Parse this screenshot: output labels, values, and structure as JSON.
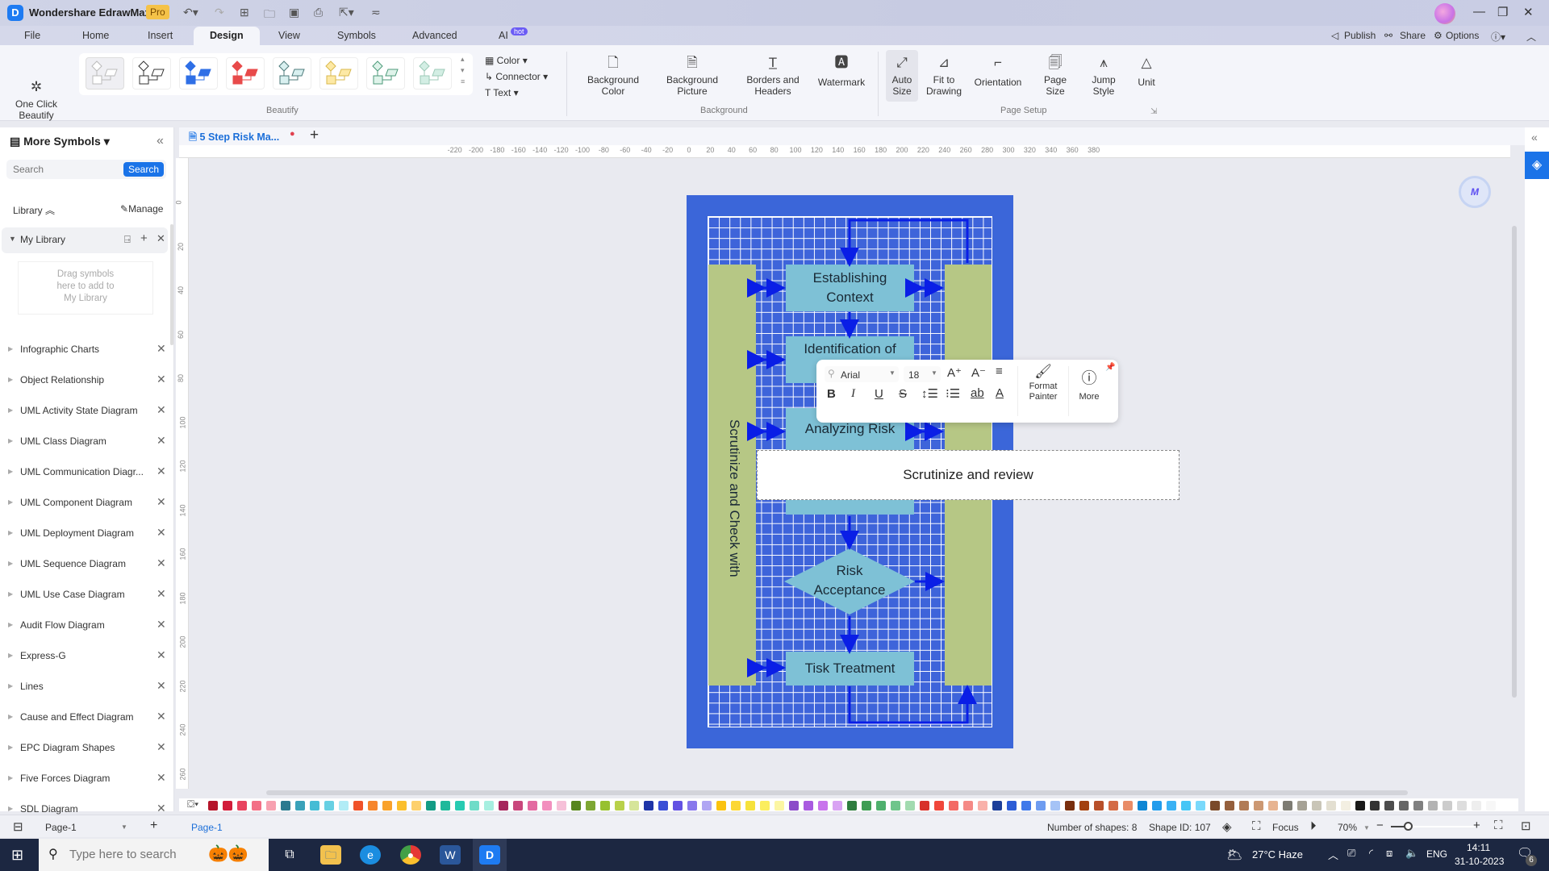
{
  "app": {
    "title": "Wondershare EdrawMax",
    "badge": "Pro",
    "window_controls": [
      "minimize",
      "restore",
      "close"
    ]
  },
  "quick_access": [
    "undo",
    "redo",
    "new",
    "open",
    "save",
    "print",
    "export",
    "customize"
  ],
  "menu": {
    "tabs": [
      "File",
      "Home",
      "Insert",
      "Design",
      "View",
      "Symbols",
      "Advanced",
      "AI"
    ],
    "active": "Design",
    "ai_badge": "hot",
    "right": {
      "publish": "Publish",
      "share": "Share",
      "options": "Options"
    }
  },
  "ribbon": {
    "one_click_beautify": "One Click\nBeautify",
    "beautify_label": "Beautify",
    "color": "Color",
    "connector": "Connector",
    "text": "Text",
    "background_group": "Background",
    "background_color": "Background\nColor",
    "background_picture": "Background\nPicture",
    "borders_headers": "Borders and\nHeaders",
    "watermark": "Watermark",
    "page_setup_group": "Page Setup",
    "auto_size": "Auto\nSize",
    "fit_to_drawing": "Fit to\nDrawing",
    "orientation": "Orientation",
    "page_size": "Page\nSize",
    "jump_style": "Jump\nStyle",
    "unit": "Unit"
  },
  "left_panel": {
    "title": "More Symbols",
    "search_placeholder": "Search",
    "search_button": "Search",
    "library_label": "Library",
    "manage_label": "Manage",
    "my_library": "My Library",
    "drop_hint": "Drag symbols\nhere to add to\nMy Library",
    "libraries": [
      "Infographic Charts",
      "Object Relationship",
      "UML Activity State Diagram",
      "UML Class Diagram",
      "UML Communication Diagr...",
      "UML Component Diagram",
      "UML Deployment Diagram",
      "UML Sequence Diagram",
      "UML Use Case Diagram",
      "Audit Flow Diagram",
      "Express-G",
      "Lines",
      "Cause and Effect Diagram",
      "EPC Diagram Shapes",
      "Five Forces Diagram",
      "SDL Diagram"
    ]
  },
  "document": {
    "tab_title": "5 Step Risk Ma...",
    "unsaved": true
  },
  "rulers": {
    "horizontal": [
      "-220",
      "-200",
      "-180",
      "-160",
      "-140",
      "-120",
      "-100",
      "-80",
      "-60",
      "-40",
      "-20",
      "0",
      "20",
      "40",
      "60",
      "80",
      "100",
      "120",
      "140",
      "160",
      "180",
      "200",
      "220",
      "240",
      "260",
      "280",
      "300",
      "320",
      "340",
      "360",
      "380"
    ],
    "vertical": [
      "0",
      "20",
      "40",
      "60",
      "80",
      "100",
      "120",
      "140",
      "160",
      "180",
      "200",
      "220",
      "240",
      "260"
    ]
  },
  "diagram": {
    "steps": [
      "Establishing\nContext",
      "Identification of",
      "Analyzing Risk",
      "Risk\nAcceptance",
      "Tisk Treatment"
    ],
    "side_label": "Scrutinize and Check with",
    "editing_text": "Scrutinize and review",
    "colors": {
      "page": "#3b66d9",
      "box": "#7ec1d6",
      "side": "#b6c785",
      "arrow": "#0a1ee6"
    }
  },
  "floating_toolbar": {
    "font": "Arial",
    "size": "18",
    "format_painter": "Format\nPainter",
    "more": "More"
  },
  "palette": [
    "#b5152b",
    "#d21c3a",
    "#e8435f",
    "#f36f86",
    "#f7a1b0",
    "#2b7a8f",
    "#3aa2b9",
    "#45bcd5",
    "#67d0e3",
    "#b1ecf6",
    "#f0522a",
    "#f6862e",
    "#f9a22b",
    "#fbbf2d",
    "#fdd06c",
    "#139c85",
    "#1fb99b",
    "#27cbb2",
    "#6fdcc8",
    "#a7efe0",
    "#a6265c",
    "#c9477c",
    "#e36aa1",
    "#f28fbe",
    "#f6c0d8",
    "#57861f",
    "#7ea733",
    "#97c12f",
    "#b9d14a",
    "#d6e59a",
    "#1f35a8",
    "#3a4fd6",
    "#6352e3",
    "#8878ec",
    "#b0a6f3",
    "#fbc310",
    "#fcd734",
    "#f6e23b",
    "#fbee5e",
    "#fcf6a3",
    "#8b4bc9",
    "#a95ae0",
    "#c874ec",
    "#d9a3f3",
    "#2f7d3f",
    "#3e9d54",
    "#4fb06d",
    "#6fc58b",
    "#a2dbb0",
    "#d8322a",
    "#f0473b",
    "#f36a64",
    "#f58a86",
    "#f9b1aa",
    "#1d3f9a",
    "#2d5dd6",
    "#3f79ea",
    "#6e9cf0",
    "#a5c3f6",
    "#7a2f0e",
    "#a3410f",
    "#b8502a",
    "#d46b46",
    "#e98c67",
    "#0e86d4",
    "#229cec",
    "#3ab2f4",
    "#47c6f6",
    "#7ad9fb",
    "#7a4a2a",
    "#95603d",
    "#b17b56",
    "#cc9872",
    "#e7b491",
    "#7e7c73",
    "#a6a295",
    "#c9c5b7",
    "#e3dfd1",
    "#f3efe2",
    "#1a1a1a",
    "#333333",
    "#4d4d4d",
    "#666666",
    "#808080",
    "#b3b3b3",
    "#cccccc",
    "#dddddd",
    "#eeeeee",
    "#f7f7f7"
  ],
  "status": {
    "page_selector": "Page-1",
    "active_page": "Page-1",
    "shapes": "Number of shapes: 8",
    "shape_id": "Shape ID: 107",
    "focus": "Focus",
    "zoom": "70%"
  },
  "taskbar": {
    "search_placeholder": "Type here to search",
    "weather": "27°C  Haze",
    "lang": "ENG",
    "time": "14:11",
    "date": "31-10-2023",
    "notifications": "6"
  }
}
